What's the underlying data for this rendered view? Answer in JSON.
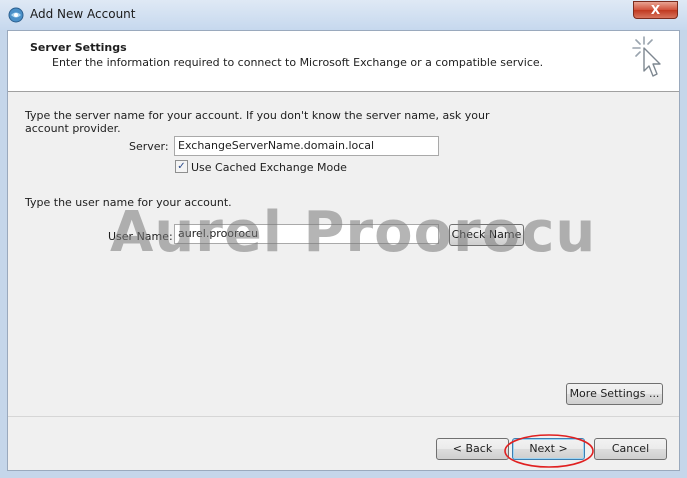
{
  "window": {
    "title": "Add New Account",
    "close_glyph": "X"
  },
  "header": {
    "title": "Server Settings",
    "subtitle": "Enter the information required to connect to Microsoft Exchange or a compatible service.",
    "icon": "wizard-cursor-icon"
  },
  "server_section": {
    "instruction_line1": "Type the server name for your account. If you don't know the server name, ask your",
    "instruction_line2": "account provider.",
    "server_label": "Server:",
    "server_value": "ExchangeServerName.domain.local",
    "cached_mode_label": "Use Cached Exchange Mode",
    "cached_mode_checked": true
  },
  "user_section": {
    "instruction": "Type the user name for your account.",
    "user_label": "User Name:",
    "user_value": "aurel.proorocu",
    "check_name_label": "Check Name"
  },
  "watermark": "Aurel Proorocu",
  "buttons": {
    "more_settings": "More Settings ...",
    "back": "< Back",
    "next": "Next >",
    "cancel": "Cancel"
  },
  "colors": {
    "annotation": "#e02020"
  }
}
